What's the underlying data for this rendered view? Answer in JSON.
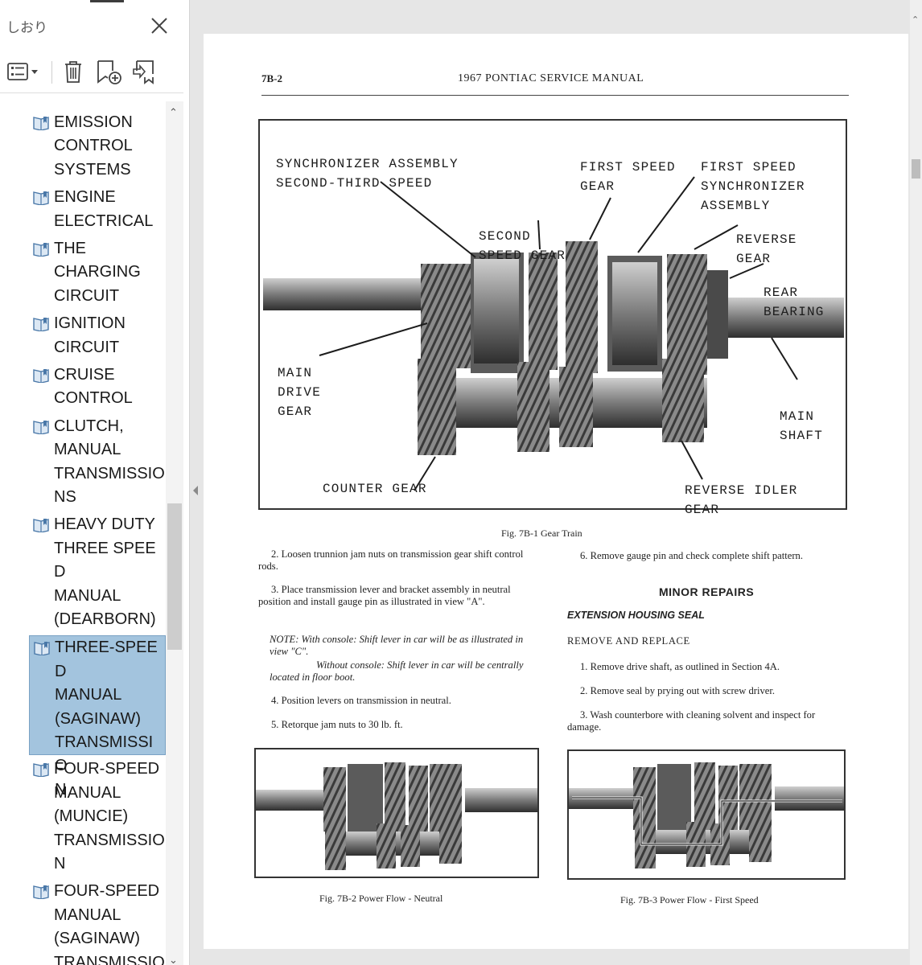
{
  "panel": {
    "title": "しおり",
    "bookmarks": [
      {
        "label": "EMISSION\nCONTROL\nSYSTEMS"
      },
      {
        "label": "ENGINE\nELECTRICAL"
      },
      {
        "label": "THE\nCHARGING\nCIRCUIT"
      },
      {
        "label": "IGNITION\nCIRCUIT"
      },
      {
        "label": "CRUISE\nCONTROL"
      },
      {
        "label": "CLUTCH,\nMANUAL\nTRANSMISSIO\nNS"
      },
      {
        "label": "HEAVY DUTY\nTHREE SPEED\nMANUAL\n(DEARBORN)\nTRANSMISSIO"
      },
      {
        "label": "THREE-SPEED\nMANUAL\n(SAGINAW)\nTRANSMISSIO\nN",
        "selected": true
      },
      {
        "label": "FOUR-SPEED\nMANUAL\n(MUNCIE)\nTRANSMISSIO\nN"
      },
      {
        "label": "FOUR-SPEED\nMANUAL\n(SAGINAW)\nTRANSMISSIO"
      }
    ]
  },
  "document": {
    "page_number": "7B-2",
    "header": "1967 PONTIAC SERVICE MANUAL",
    "figure1": {
      "labels": {
        "sync_23": "SYNCHRONIZER  ASSEMBLY\nSECOND-THIRD  SPEED",
        "first_gear": "FIRST  SPEED\nGEAR",
        "first_sync": "FIRST  SPEED\nSYNCHRONIZER\nASSEMBLY",
        "second_gear": "SECOND\nSPEED  GEAR",
        "reverse_gear": "REVERSE\nGEAR",
        "rear_bearing": "REAR\nBEARING",
        "main_drive": "MAIN\nDRIVE\nGEAR",
        "main_shaft": "MAIN\nSHAFT",
        "counter_gear": "COUNTER  GEAR",
        "reverse_idler": "REVERSE  IDLER\nGEAR"
      },
      "caption": "Fig. 7B-1   Gear Train"
    },
    "left_col": {
      "p2": "2. Loosen trunnion jam nuts on transmission gear shift control rods.",
      "p3": "3. Place transmission lever and bracket assembly in neutral position and install gauge pin as illustrated in view \"A\".",
      "note1": "NOTE:  With console: Shift lever in car will be as illustrated in view \"C\".",
      "note2": "Without console: Shift lever in car will be centrally located in floor boot.",
      "p4": "4. Position levers on transmission in neutral.",
      "p5": "5. Retorque jam nuts to 30 lb. ft."
    },
    "right_col": {
      "p6": "6. Remove gauge pin and check complete shift pattern.",
      "heading": "MINOR REPAIRS",
      "subhead": "EXTENSION HOUSING SEAL",
      "remove_replace": "REMOVE AND REPLACE",
      "r1": "1. Remove drive shaft, as outlined in Section 4A.",
      "r2": "2. Remove seal by prying out with screw driver.",
      "r3": "3. Wash counterbore with cleaning solvent and inspect for damage."
    },
    "fig2_caption": "Fig. 7B-2   Power Flow - Neutral",
    "fig3_caption": "Fig. 7B-3   Power Flow - First Speed"
  }
}
